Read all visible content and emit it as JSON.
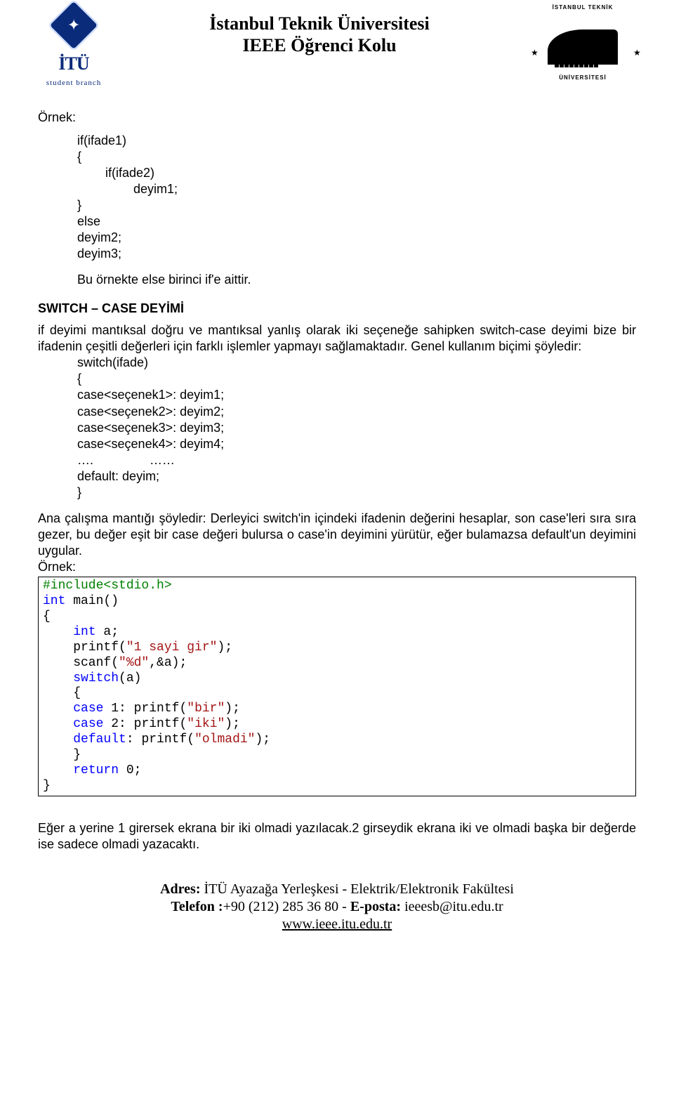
{
  "header": {
    "line1": "İstanbul Teknik Üniversitesi",
    "line2": "IEEE Öğrenci Kolu",
    "logo_left_title": "İTÜ",
    "logo_left_sub": "student  branch",
    "ring_top": "İSTANBUL TEKNİK",
    "ring_bot": "ÜNİVERSİTESİ"
  },
  "example1": {
    "label": "Örnek:",
    "line1": "if(ifade1)",
    "line2": "{",
    "line3": "        if(ifade2)",
    "line4": "                deyim1;",
    "line5": "}",
    "line6": "else",
    "line7": "deyim2;",
    "line8": "deyim3;",
    "note": "Bu örnekte else birinci if'e aittir."
  },
  "switch_section": {
    "title": "SWITCH – CASE DEYİMİ",
    "para": "if deyimi mantıksal doğru ve mantıksal yanlış olarak iki seçeneğe sahipken switch-case deyimi bize bir ifadenin çeşitli değerleri için farklı işlemler yapmayı sağlamaktadır. Genel kullanım biçimi şöyledir:",
    "code": {
      "l1": "switch(ifade)",
      "l2": "{",
      "l3": "case<seçenek1>: deyim1;",
      "l4": "case<seçenek2>: deyim2;",
      "l5": "case<seçenek3>: deyim3;",
      "l6": "case<seçenek4>: deyim4;",
      "l7": "….                ……",
      "l8": "default: deyim;",
      "l9": "}"
    }
  },
  "explain": {
    "para": "Ana çalışma mantığı şöyledir: Derleyici switch'in içindeki ifadenin değerini hesaplar, son case'leri sıra sıra gezer, bu değer eşit bir case değeri bulursa o case'in deyimini yürütür, eğer bulamazsa default'un deyimini uygular.",
    "label": "Örnek:"
  },
  "csample": {
    "l1": "#include<stdio.h>",
    "l2a": "int",
    "l2b": " main()",
    "l3": "{",
    "l4a": "    ",
    "l4b": "int",
    "l4c": " a;",
    "l5a": "    printf(",
    "l5b": "\"1 sayi gir\"",
    "l5c": ");",
    "l6a": "    scanf(",
    "l6b": "\"%d\"",
    "l6c": ",&a);",
    "l7a": "    ",
    "l7b": "switch",
    "l7c": "(a)",
    "l8": "    {",
    "l9a": "    ",
    "l9b": "case",
    "l9c": " 1: printf(",
    "l9d": "\"bir\"",
    "l9e": ");",
    "l10a": "    ",
    "l10b": "case",
    "l10c": " 2: printf(",
    "l10d": "\"iki\"",
    "l10e": ");",
    "l11a": "    ",
    "l11b": "default",
    "l11c": ": printf(",
    "l11d": "\"olmadi\"",
    "l11e": ");",
    "l12": "    }",
    "l13a": "    ",
    "l13b": "return",
    "l13c": " 0;",
    "l14": "}"
  },
  "after": {
    "para": "Eğer a yerine 1 girersek ekrana bir iki olmadi yazılacak.2 girseydik ekrana iki ve olmadi başka bir değerde ise sadece olmadi yazacaktı."
  },
  "footer": {
    "addr_b": "Adres:",
    "addr": " İTÜ Ayazağa Yerleşkesi - Elektrik/Elektronik Fakültesi",
    "tel_b": "Telefon :",
    "tel": "+90 (212) 285 36 80 - ",
    "mail_b": "E-posta:",
    "mail": " ieeesb@itu.edu.tr",
    "web": "www.ieee.itu.edu.tr"
  }
}
